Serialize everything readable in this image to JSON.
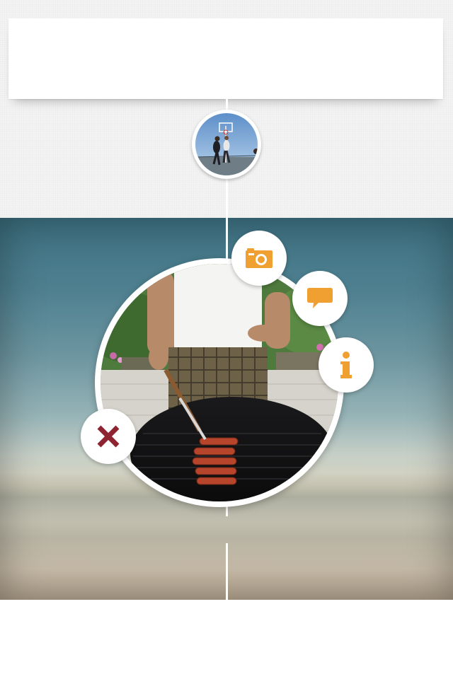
{
  "colors": {
    "accent_orange": "#f0a030",
    "close_red": "#8e2432",
    "card_white": "#ffffff",
    "background": "#f2f2f2"
  },
  "header_card": {
    "text": ""
  },
  "timeline": {
    "top_thumbnail": {
      "icon": "basketball-photo-thumbnail"
    }
  },
  "featured_post": {
    "photo": "grill-photo",
    "actions": [
      {
        "name": "camera",
        "icon": "camera-icon"
      },
      {
        "name": "comment",
        "icon": "speech-bubble-icon"
      },
      {
        "name": "info",
        "icon": "info-icon"
      },
      {
        "name": "close",
        "icon": "close-x-icon"
      }
    ]
  }
}
